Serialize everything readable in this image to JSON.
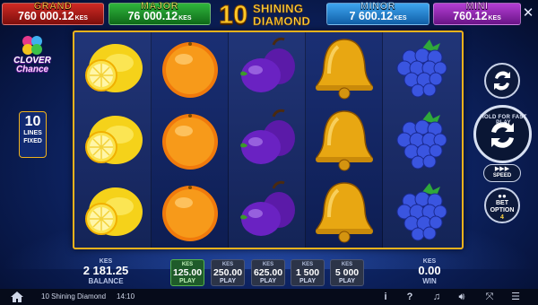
{
  "jackpots": [
    {
      "id": "grand",
      "name": "GRAND",
      "amount": "760 000.12",
      "currency": "KES"
    },
    {
      "id": "major",
      "name": "MAJOR",
      "amount": "76 000.12",
      "currency": "KES"
    },
    {
      "id": "minor",
      "name": "MINOR",
      "amount": "7 600.12",
      "currency": "KES"
    },
    {
      "id": "mini",
      "name": "MINI",
      "amount": "760.12",
      "currency": "KES"
    }
  ],
  "title": {
    "number": "10",
    "line1": "SHINING",
    "line2": "DIAMOND"
  },
  "clover": {
    "line1": "CLOVER",
    "line2": "Chance"
  },
  "lines_badge": {
    "number": "10",
    "line1": "LINES",
    "line2": "FIXED"
  },
  "reels": [
    [
      "lemon",
      "lemon",
      "lemon"
    ],
    [
      "orange",
      "orange",
      "orange"
    ],
    [
      "plum",
      "plum",
      "plum"
    ],
    [
      "bell",
      "bell",
      "bell"
    ],
    [
      "grapes",
      "grapes",
      "grapes"
    ]
  ],
  "controls": {
    "spin_hint": "HOLD FOR FAST PLAY",
    "speed_label": "SPEED",
    "speed_icon": "fast-forward-icon",
    "bet_option_label": "BET OPTION",
    "bet_option_value": "4",
    "autoplay_icon": "autoplay-icon"
  },
  "balance": {
    "currency": "KES",
    "amount": "2 181.25",
    "label": "BALANCE"
  },
  "win": {
    "currency": "KES",
    "amount": "0.00",
    "label": "WIN"
  },
  "bets": [
    {
      "currency": "KES",
      "amount": "125.00",
      "label": "PLAY",
      "active": true
    },
    {
      "currency": "KES",
      "amount": "250.00",
      "label": "PLAY",
      "active": false
    },
    {
      "currency": "KES",
      "amount": "625.00",
      "label": "PLAY",
      "active": false
    },
    {
      "currency": "KES",
      "amount": "1 500",
      "label": "PLAY",
      "active": false
    },
    {
      "currency": "KES",
      "amount": "5 000",
      "label": "PLAY",
      "active": false
    }
  ],
  "status_bar": {
    "game_name": "10 Shining Diamond",
    "time": "14:10",
    "icons": [
      "info-icon",
      "help-icon",
      "music-icon",
      "sound-icon",
      "fullscreen-icon",
      "menu-icon"
    ]
  },
  "colors": {
    "reel_frame": "#f2b21c",
    "active_bet": "#1f5b2a",
    "background": "#0e2566"
  }
}
